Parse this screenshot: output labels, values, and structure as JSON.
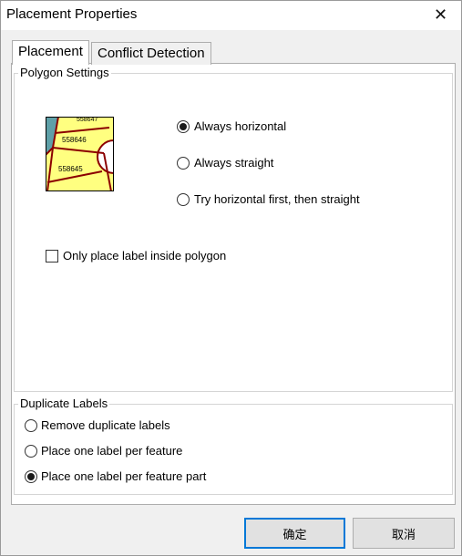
{
  "window": {
    "title": "Placement Properties",
    "close_glyph": "✕"
  },
  "tabs": [
    {
      "label": "Placement",
      "active": true
    },
    {
      "label": "Conflict Detection",
      "active": false
    }
  ],
  "polygon_settings": {
    "title": "Polygon Settings",
    "preview_labels": [
      "558647",
      "558646",
      "558645"
    ],
    "orientation_options": [
      {
        "label": "Always horizontal",
        "selected": true
      },
      {
        "label": "Always straight",
        "selected": false
      },
      {
        "label": "Try horizontal first, then straight",
        "selected": false
      }
    ],
    "inside_polygon": {
      "label": "Only place label inside polygon",
      "checked": false
    }
  },
  "duplicate_labels": {
    "title": "Duplicate Labels",
    "options": [
      {
        "label": "Remove duplicate labels",
        "selected": false
      },
      {
        "label": "Place one label per feature",
        "selected": false
      },
      {
        "label": "Place one label per feature part",
        "selected": true
      }
    ]
  },
  "buttons": {
    "ok": "确定",
    "cancel": "取消"
  },
  "colors": {
    "accent": "#0078d7",
    "polygon_fill": "#ffff80",
    "polygon_edge": "#8b0000",
    "water": "#5fa0a8"
  }
}
